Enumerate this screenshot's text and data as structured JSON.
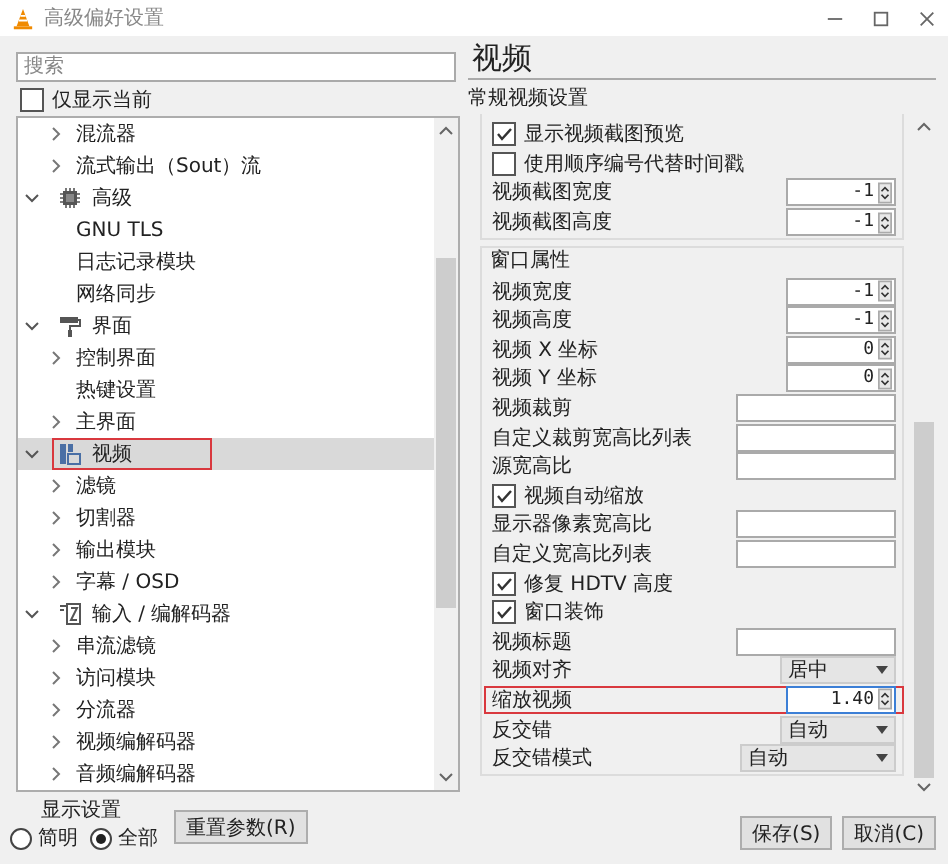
{
  "window": {
    "title": "高级偏好设置"
  },
  "search": {
    "placeholder": "搜索"
  },
  "show_current": {
    "label": "仅显示当前",
    "checked": false
  },
  "tree": {
    "continued_children": [
      {
        "label": "混流器",
        "expandable": true
      },
      {
        "label": "流式输出（Sout）流",
        "expandable": true
      }
    ],
    "categories": [
      {
        "label": "高级",
        "expanded": true,
        "selected": false,
        "highlighted": false,
        "children": [
          {
            "label": "GNU TLS",
            "expandable": false
          },
          {
            "label": "日志记录模块",
            "expandable": false
          },
          {
            "label": "网络同步",
            "expandable": false
          }
        ]
      },
      {
        "label": "界面",
        "expanded": true,
        "selected": false,
        "highlighted": false,
        "children": [
          {
            "label": "控制界面",
            "expandable": true
          },
          {
            "label": "热键设置",
            "expandable": false
          },
          {
            "label": "主界面",
            "expandable": true
          }
        ]
      },
      {
        "label": "视频",
        "expanded": true,
        "selected": true,
        "highlighted": true,
        "children": [
          {
            "label": "滤镜",
            "expandable": true
          },
          {
            "label": "切割器",
            "expandable": true
          },
          {
            "label": "输出模块",
            "expandable": true
          },
          {
            "label": "字幕 / OSD",
            "expandable": true
          }
        ]
      },
      {
        "label": "输入 / 编解码器",
        "expanded": true,
        "selected": false,
        "highlighted": false,
        "children": [
          {
            "label": "串流滤镜",
            "expandable": true
          },
          {
            "label": "访问模块",
            "expandable": true
          },
          {
            "label": "分流器",
            "expandable": true
          },
          {
            "label": "视频编解码器",
            "expandable": true
          },
          {
            "label": "音频编解码器",
            "expandable": true
          }
        ]
      }
    ]
  },
  "display_settings": {
    "title": "显示设置",
    "options": [
      {
        "label": "简明",
        "selected": false
      },
      {
        "label": "全部",
        "selected": true
      }
    ]
  },
  "reset_button": "重置参数(R)",
  "section_title": "视频",
  "section_subtitle": "常规视频设置",
  "general_options": [
    {
      "kind": "checkbox",
      "label": "显示视频截图预览",
      "checked": true
    },
    {
      "kind": "checkbox",
      "label": "使用顺序编号代替时间戳",
      "checked": false
    },
    {
      "kind": "spin",
      "label": "视频截图宽度",
      "value": "-1",
      "highlighted": false
    },
    {
      "kind": "spin",
      "label": "视频截图高度",
      "value": "-1",
      "highlighted": false
    }
  ],
  "window_properties": {
    "title": "窗口属性",
    "options": [
      {
        "kind": "spin",
        "label": "视频宽度",
        "value": "-1",
        "highlighted": false
      },
      {
        "kind": "spin",
        "label": "视频高度",
        "value": "-1",
        "highlighted": false
      },
      {
        "kind": "spin",
        "label": "视频 X 坐标",
        "value": "0",
        "highlighted": false
      },
      {
        "kind": "spin",
        "label": "视频 Y 坐标",
        "value": "0",
        "highlighted": false
      },
      {
        "kind": "text",
        "label": "视频裁剪"
      },
      {
        "kind": "text",
        "label": "自定义裁剪宽高比列表"
      },
      {
        "kind": "text",
        "label": "源宽高比"
      },
      {
        "kind": "checkbox",
        "label": "视频自动缩放",
        "checked": true
      },
      {
        "kind": "text",
        "label": "显示器像素宽高比"
      },
      {
        "kind": "text",
        "label": "自定义宽高比列表"
      },
      {
        "kind": "checkbox",
        "label": "修复 HDTV 高度",
        "checked": true
      },
      {
        "kind": "checkbox",
        "label": "窗口装饰",
        "checked": true
      },
      {
        "kind": "text",
        "label": "视频标题"
      },
      {
        "kind": "dropdown",
        "label": "视频对齐",
        "value": "居中",
        "wide": false
      },
      {
        "kind": "spin",
        "label": "缩放视频",
        "value": "1.40",
        "highlighted": true
      },
      {
        "kind": "dropdown",
        "label": "反交错",
        "value": "自动",
        "wide": false
      },
      {
        "kind": "dropdown",
        "label": "反交错模式",
        "value": "自动",
        "wide": true
      }
    ]
  },
  "buttons": [
    "保存(S)",
    "取消(C)"
  ]
}
